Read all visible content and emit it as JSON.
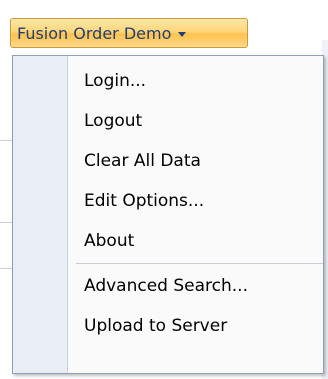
{
  "menu_button": {
    "label": "Fusion Order Demo",
    "arrow_icon": "chevron-down-icon"
  },
  "menu": {
    "group1": [
      "Login...",
      "Logout",
      "Clear All Data",
      "Edit Options...",
      "About"
    ],
    "group2": [
      "Advanced Search...",
      "Upload to Server"
    ]
  },
  "colors": {
    "button_top": "#ffe8a8",
    "button_bottom": "#ffc24e",
    "button_border": "#c89a3f",
    "button_text": "#1f3f74",
    "menu_background": "#fafafa",
    "gutter": "#e9eef5",
    "border": "#8f9fb6"
  }
}
